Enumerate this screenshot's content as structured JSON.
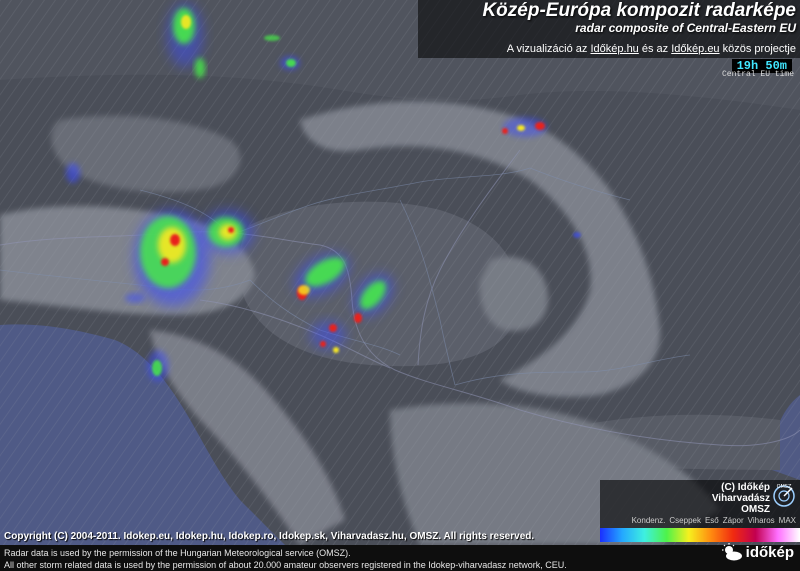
{
  "header": {
    "title": "Közép-Európa kompozit radarképe",
    "subtitle": "radar composite of Central-Eastern EU",
    "project_prefix": "A vizualizáció az",
    "project_link1": "Időkép.hu",
    "project_middle": "és az",
    "project_link2": "Időkép.eu",
    "project_suffix": "közös projectje",
    "time": "19h 50m",
    "timezone": "Central EU time"
  },
  "logo": {
    "line1": "(C) Időkép",
    "line2": "Viharvadász",
    "line3": "OMSZ",
    "icon": "omsz-radar-icon"
  },
  "legend": {
    "labels": [
      "Kondenz.",
      "Cseppek",
      "Eső",
      "Zápor",
      "Viharos",
      "MAX"
    ],
    "colors": [
      "#1a2fff",
      "#24a8ff",
      "#3ef0e0",
      "#4ef24a",
      "#f6f01e",
      "#ff8a10",
      "#f02a10",
      "#c20050",
      "#ff70ff",
      "#ffffff"
    ]
  },
  "footer": {
    "copyright": "Copyright (C) 2004-2011. Idokep.eu, Idokep.hu, Idokep.ro, Idokep.sk, Viharvadasz.hu, OMSZ. All rights reserved.",
    "note1": "Radar data is used by the permission of the Hungarian Meteorological service (OMSZ).",
    "note2": "All other storm related data is used by the permission of about 20.000 amateur observers registered in the Idokep-viharvadasz network, CEU.",
    "brand": "időkép",
    "brand_icon": "sun-cloud-icon"
  },
  "colors": {
    "sea": "#4f5a86",
    "land": "#4a4e58",
    "plains": "#5a5e68",
    "mountains": "#8c909a",
    "radar_low": "#3a4cff",
    "radar_mid": "#47e84a",
    "radar_high": "#f8e820",
    "radar_max": "#e8201c"
  }
}
